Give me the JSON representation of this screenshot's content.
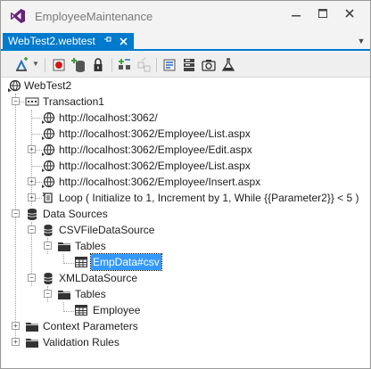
{
  "window": {
    "title": "EmployeeMaintenance",
    "controls": [
      "minimize-icon",
      "maximize-icon",
      "close-icon"
    ]
  },
  "tab": {
    "label": "WebTest2.webtest",
    "pin_icon": "pin-icon",
    "close_icon": "close-icon"
  },
  "toolbar": {
    "items": [
      "add-data-source-icon",
      "record-icon",
      "add-recording-icon",
      "lock-icon",
      "parameterize-icon",
      "insert-request-icon",
      "generate-code-icon",
      "set-credentials-icon",
      "add-validation-rule-icon",
      "performance-session-icon"
    ]
  },
  "tree": {
    "root": "WebTest2",
    "transaction": "Transaction1",
    "requests": [
      "http://localhost:3062/",
      "http://localhost:3062/Employee/List.aspx",
      "http://localhost:3062/Employee/Edit.aspx",
      "http://localhost:3062/Employee/List.aspx",
      "http://localhost:3062/Employee/Insert.aspx"
    ],
    "loop": "Loop ( Initialize to 1, Increment by 1, While {{Parameter2}} < 5 )",
    "data_sources": "Data Sources",
    "csv_source": "CSVFileDataSource",
    "csv_tables": "Tables",
    "csv_table": "EmpData#csv",
    "xml_source": "XMLDataSource",
    "xml_tables": "Tables",
    "xml_table": "Employee",
    "context_parameters": "Context Parameters",
    "validation_rules": "Validation Rules"
  },
  "colors": {
    "accent": "#007acc",
    "selection": "#3399ff"
  }
}
